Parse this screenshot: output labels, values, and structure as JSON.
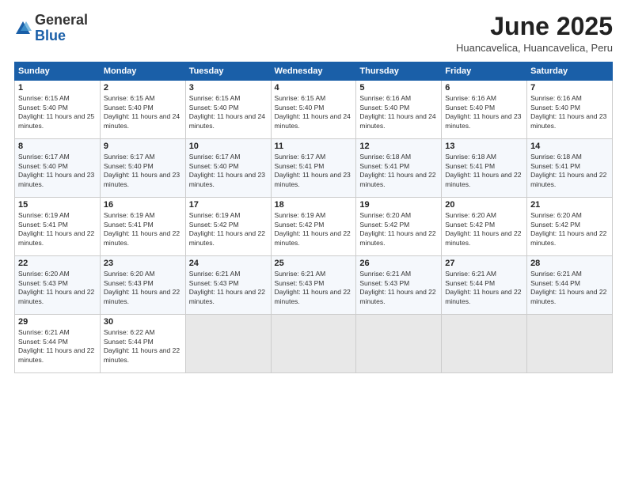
{
  "logo": {
    "general": "General",
    "blue": "Blue"
  },
  "title": "June 2025",
  "location": "Huancavelica, Huancavelica, Peru",
  "days_of_week": [
    "Sunday",
    "Monday",
    "Tuesday",
    "Wednesday",
    "Thursday",
    "Friday",
    "Saturday"
  ],
  "weeks": [
    [
      {
        "day": "1",
        "sunrise": "6:15 AM",
        "sunset": "5:40 PM",
        "daylight": "11 hours and 25 minutes."
      },
      {
        "day": "2",
        "sunrise": "6:15 AM",
        "sunset": "5:40 PM",
        "daylight": "11 hours and 24 minutes."
      },
      {
        "day": "3",
        "sunrise": "6:15 AM",
        "sunset": "5:40 PM",
        "daylight": "11 hours and 24 minutes."
      },
      {
        "day": "4",
        "sunrise": "6:15 AM",
        "sunset": "5:40 PM",
        "daylight": "11 hours and 24 minutes."
      },
      {
        "day": "5",
        "sunrise": "6:16 AM",
        "sunset": "5:40 PM",
        "daylight": "11 hours and 24 minutes."
      },
      {
        "day": "6",
        "sunrise": "6:16 AM",
        "sunset": "5:40 PM",
        "daylight": "11 hours and 23 minutes."
      },
      {
        "day": "7",
        "sunrise": "6:16 AM",
        "sunset": "5:40 PM",
        "daylight": "11 hours and 23 minutes."
      }
    ],
    [
      {
        "day": "8",
        "sunrise": "6:17 AM",
        "sunset": "5:40 PM",
        "daylight": "11 hours and 23 minutes."
      },
      {
        "day": "9",
        "sunrise": "6:17 AM",
        "sunset": "5:40 PM",
        "daylight": "11 hours and 23 minutes."
      },
      {
        "day": "10",
        "sunrise": "6:17 AM",
        "sunset": "5:40 PM",
        "daylight": "11 hours and 23 minutes."
      },
      {
        "day": "11",
        "sunrise": "6:17 AM",
        "sunset": "5:41 PM",
        "daylight": "11 hours and 23 minutes."
      },
      {
        "day": "12",
        "sunrise": "6:18 AM",
        "sunset": "5:41 PM",
        "daylight": "11 hours and 22 minutes."
      },
      {
        "day": "13",
        "sunrise": "6:18 AM",
        "sunset": "5:41 PM",
        "daylight": "11 hours and 22 minutes."
      },
      {
        "day": "14",
        "sunrise": "6:18 AM",
        "sunset": "5:41 PM",
        "daylight": "11 hours and 22 minutes."
      }
    ],
    [
      {
        "day": "15",
        "sunrise": "6:19 AM",
        "sunset": "5:41 PM",
        "daylight": "11 hours and 22 minutes."
      },
      {
        "day": "16",
        "sunrise": "6:19 AM",
        "sunset": "5:41 PM",
        "daylight": "11 hours and 22 minutes."
      },
      {
        "day": "17",
        "sunrise": "6:19 AM",
        "sunset": "5:42 PM",
        "daylight": "11 hours and 22 minutes."
      },
      {
        "day": "18",
        "sunrise": "6:19 AM",
        "sunset": "5:42 PM",
        "daylight": "11 hours and 22 minutes."
      },
      {
        "day": "19",
        "sunrise": "6:20 AM",
        "sunset": "5:42 PM",
        "daylight": "11 hours and 22 minutes."
      },
      {
        "day": "20",
        "sunrise": "6:20 AM",
        "sunset": "5:42 PM",
        "daylight": "11 hours and 22 minutes."
      },
      {
        "day": "21",
        "sunrise": "6:20 AM",
        "sunset": "5:42 PM",
        "daylight": "11 hours and 22 minutes."
      }
    ],
    [
      {
        "day": "22",
        "sunrise": "6:20 AM",
        "sunset": "5:43 PM",
        "daylight": "11 hours and 22 minutes."
      },
      {
        "day": "23",
        "sunrise": "6:20 AM",
        "sunset": "5:43 PM",
        "daylight": "11 hours and 22 minutes."
      },
      {
        "day": "24",
        "sunrise": "6:21 AM",
        "sunset": "5:43 PM",
        "daylight": "11 hours and 22 minutes."
      },
      {
        "day": "25",
        "sunrise": "6:21 AM",
        "sunset": "5:43 PM",
        "daylight": "11 hours and 22 minutes."
      },
      {
        "day": "26",
        "sunrise": "6:21 AM",
        "sunset": "5:43 PM",
        "daylight": "11 hours and 22 minutes."
      },
      {
        "day": "27",
        "sunrise": "6:21 AM",
        "sunset": "5:44 PM",
        "daylight": "11 hours and 22 minutes."
      },
      {
        "day": "28",
        "sunrise": "6:21 AM",
        "sunset": "5:44 PM",
        "daylight": "11 hours and 22 minutes."
      }
    ],
    [
      {
        "day": "29",
        "sunrise": "6:21 AM",
        "sunset": "5:44 PM",
        "daylight": "11 hours and 22 minutes."
      },
      {
        "day": "30",
        "sunrise": "6:22 AM",
        "sunset": "5:44 PM",
        "daylight": "11 hours and 22 minutes."
      },
      null,
      null,
      null,
      null,
      null
    ]
  ]
}
